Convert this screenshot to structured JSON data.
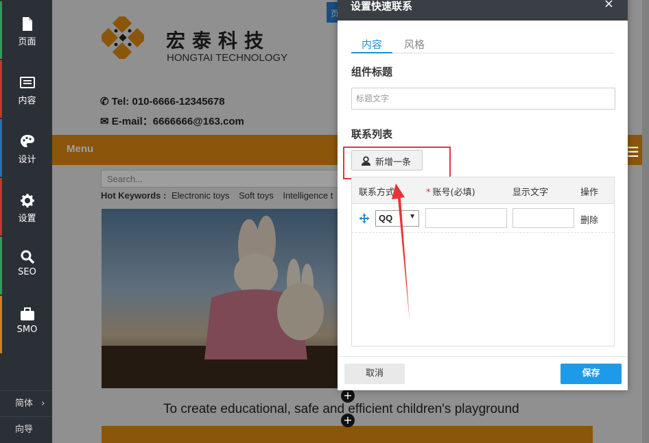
{
  "sidebar": {
    "items": [
      {
        "label": "页面",
        "icon": "page-icon"
      },
      {
        "label": "内容",
        "icon": "content-icon"
      },
      {
        "label": "设计",
        "icon": "palette-icon"
      },
      {
        "label": "设置",
        "icon": "gear-icon"
      },
      {
        "label": "SEO",
        "icon": "search-icon"
      },
      {
        "label": "SMO",
        "icon": "briefcase-icon"
      }
    ],
    "language": "简体",
    "language_arrow": "›",
    "guide": "向导"
  },
  "preview": {
    "brand_cn": "宏泰科技",
    "brand_en": "HONGTAI TECHNOLOGY",
    "tel": "Tel: 010-6666-12345678",
    "email": "E-mail：6666666@163.com",
    "menu": "Menu",
    "search_placeholder": "Search...",
    "hot_keywords_label": "Hot Keywords :",
    "hot_keywords": [
      "Electronic toys",
      "Soft toys",
      "Intelligence t"
    ],
    "tagline": "To create educational, safe and efficient children's playground",
    "chip_text": "页"
  },
  "dialog": {
    "title": "设置快速联系",
    "close": "×",
    "tabs": [
      {
        "label": "内容",
        "active": true
      },
      {
        "label": "风格",
        "active": false
      }
    ],
    "component_title_label": "组件标题",
    "component_title_placeholder": "标题文字",
    "contact_list_label": "联系列表",
    "add_button": "新增一条",
    "table": {
      "headers": [
        "联系方式",
        "账号(必填)",
        "显示文字",
        "操作"
      ],
      "required_mark": "*",
      "rows": [
        {
          "type": "QQ",
          "account": "",
          "display": "",
          "action": "删除"
        }
      ]
    },
    "cancel": "取消",
    "save": "保存"
  },
  "colors": {
    "accent": "#1f8fd8",
    "save_button": "#1e9be8",
    "highlight": "#e8333a",
    "menu_orange": "#e08a12",
    "sidebar": "#2b2f36"
  }
}
